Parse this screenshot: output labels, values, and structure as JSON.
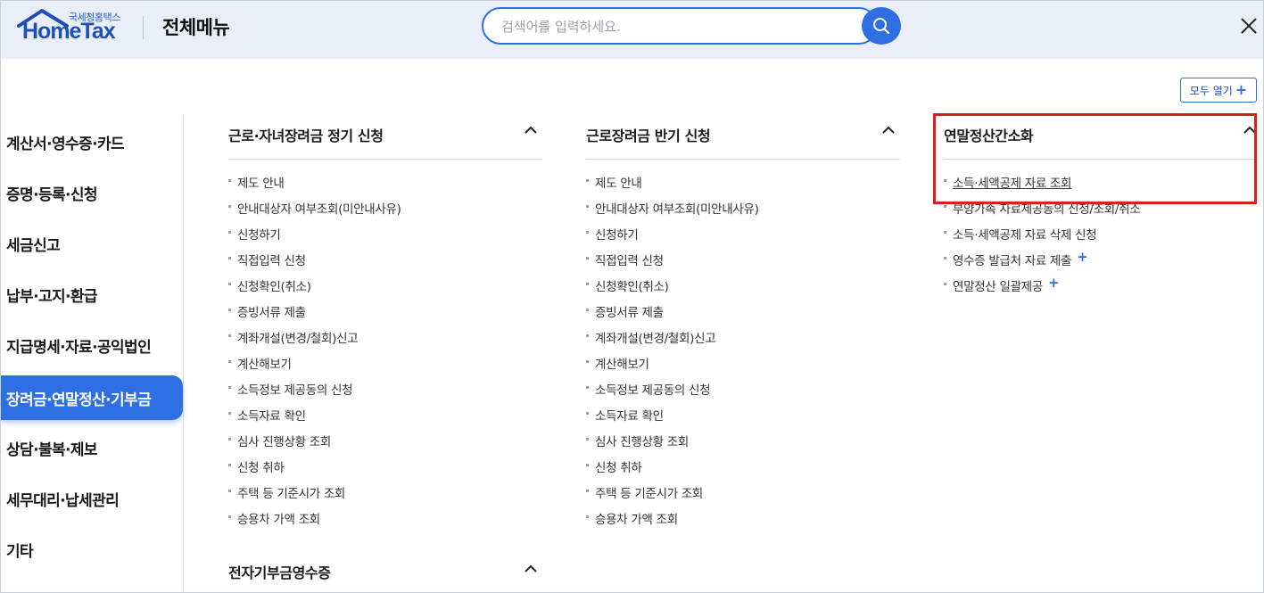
{
  "header": {
    "logo_small": "국세청홈택스",
    "logo_big": "HomeTax",
    "title": "전체메뉴",
    "search_placeholder": "검색어를 입력하세요."
  },
  "open_all_label": "모두 열기",
  "sidebar": {
    "items": [
      {
        "label": "계산서·영수증·카드",
        "active": false
      },
      {
        "label": "증명·등록·신청",
        "active": false
      },
      {
        "label": "세금신고",
        "active": false
      },
      {
        "label": "납부·고지·환급",
        "active": false
      },
      {
        "label": "지급명세·자료·공익법인",
        "active": false
      },
      {
        "label": "장려금·연말정산·기부금",
        "active": true
      },
      {
        "label": "상담·불복·제보",
        "active": false
      },
      {
        "label": "세무대리·납세관리",
        "active": false
      },
      {
        "label": "기타",
        "active": false
      }
    ]
  },
  "columns": [
    {
      "title": "근로·자녀장려금 정기 신청",
      "items": [
        "제도 안내",
        "안내대상자 여부조회(미안내사유)",
        "신청하기",
        "직접입력 신청",
        "신청확인(취소)",
        "증빙서류 제출",
        "계좌개설(변경/철회)신고",
        "계산해보기",
        "소득정보 제공동의 신청",
        "소득자료 확인",
        "심사 진행상황 조회",
        "신청 취하",
        "주택 등 기준시가 조회",
        "승용차 가액 조회"
      ]
    },
    {
      "title": "근로장려금 반기 신청",
      "items": [
        "제도 안내",
        "안내대상자 여부조회(미안내사유)",
        "신청하기",
        "직접입력 신청",
        "신청확인(취소)",
        "증빙서류 제출",
        "계좌개설(변경/철회)신고",
        "계산해보기",
        "소득정보 제공동의 신청",
        "소득자료 확인",
        "심사 진행상황 조회",
        "신청 취하",
        "주택 등 기준시가 조회",
        "승용차 가액 조회"
      ]
    },
    {
      "title": "연말정산간소화",
      "items": [
        "소득·세액공제 자료 조회",
        "부양가족 자료제공동의 신청/조회/취소",
        "소득·세액공제 자료 삭제 신청",
        "영수증 발급처 자료 제출",
        "연말정산 일괄제공"
      ]
    }
  ],
  "second_section_title": "전자기부금영수증",
  "highlight_color": "#d62020",
  "accent_color": "#2f6fe4"
}
